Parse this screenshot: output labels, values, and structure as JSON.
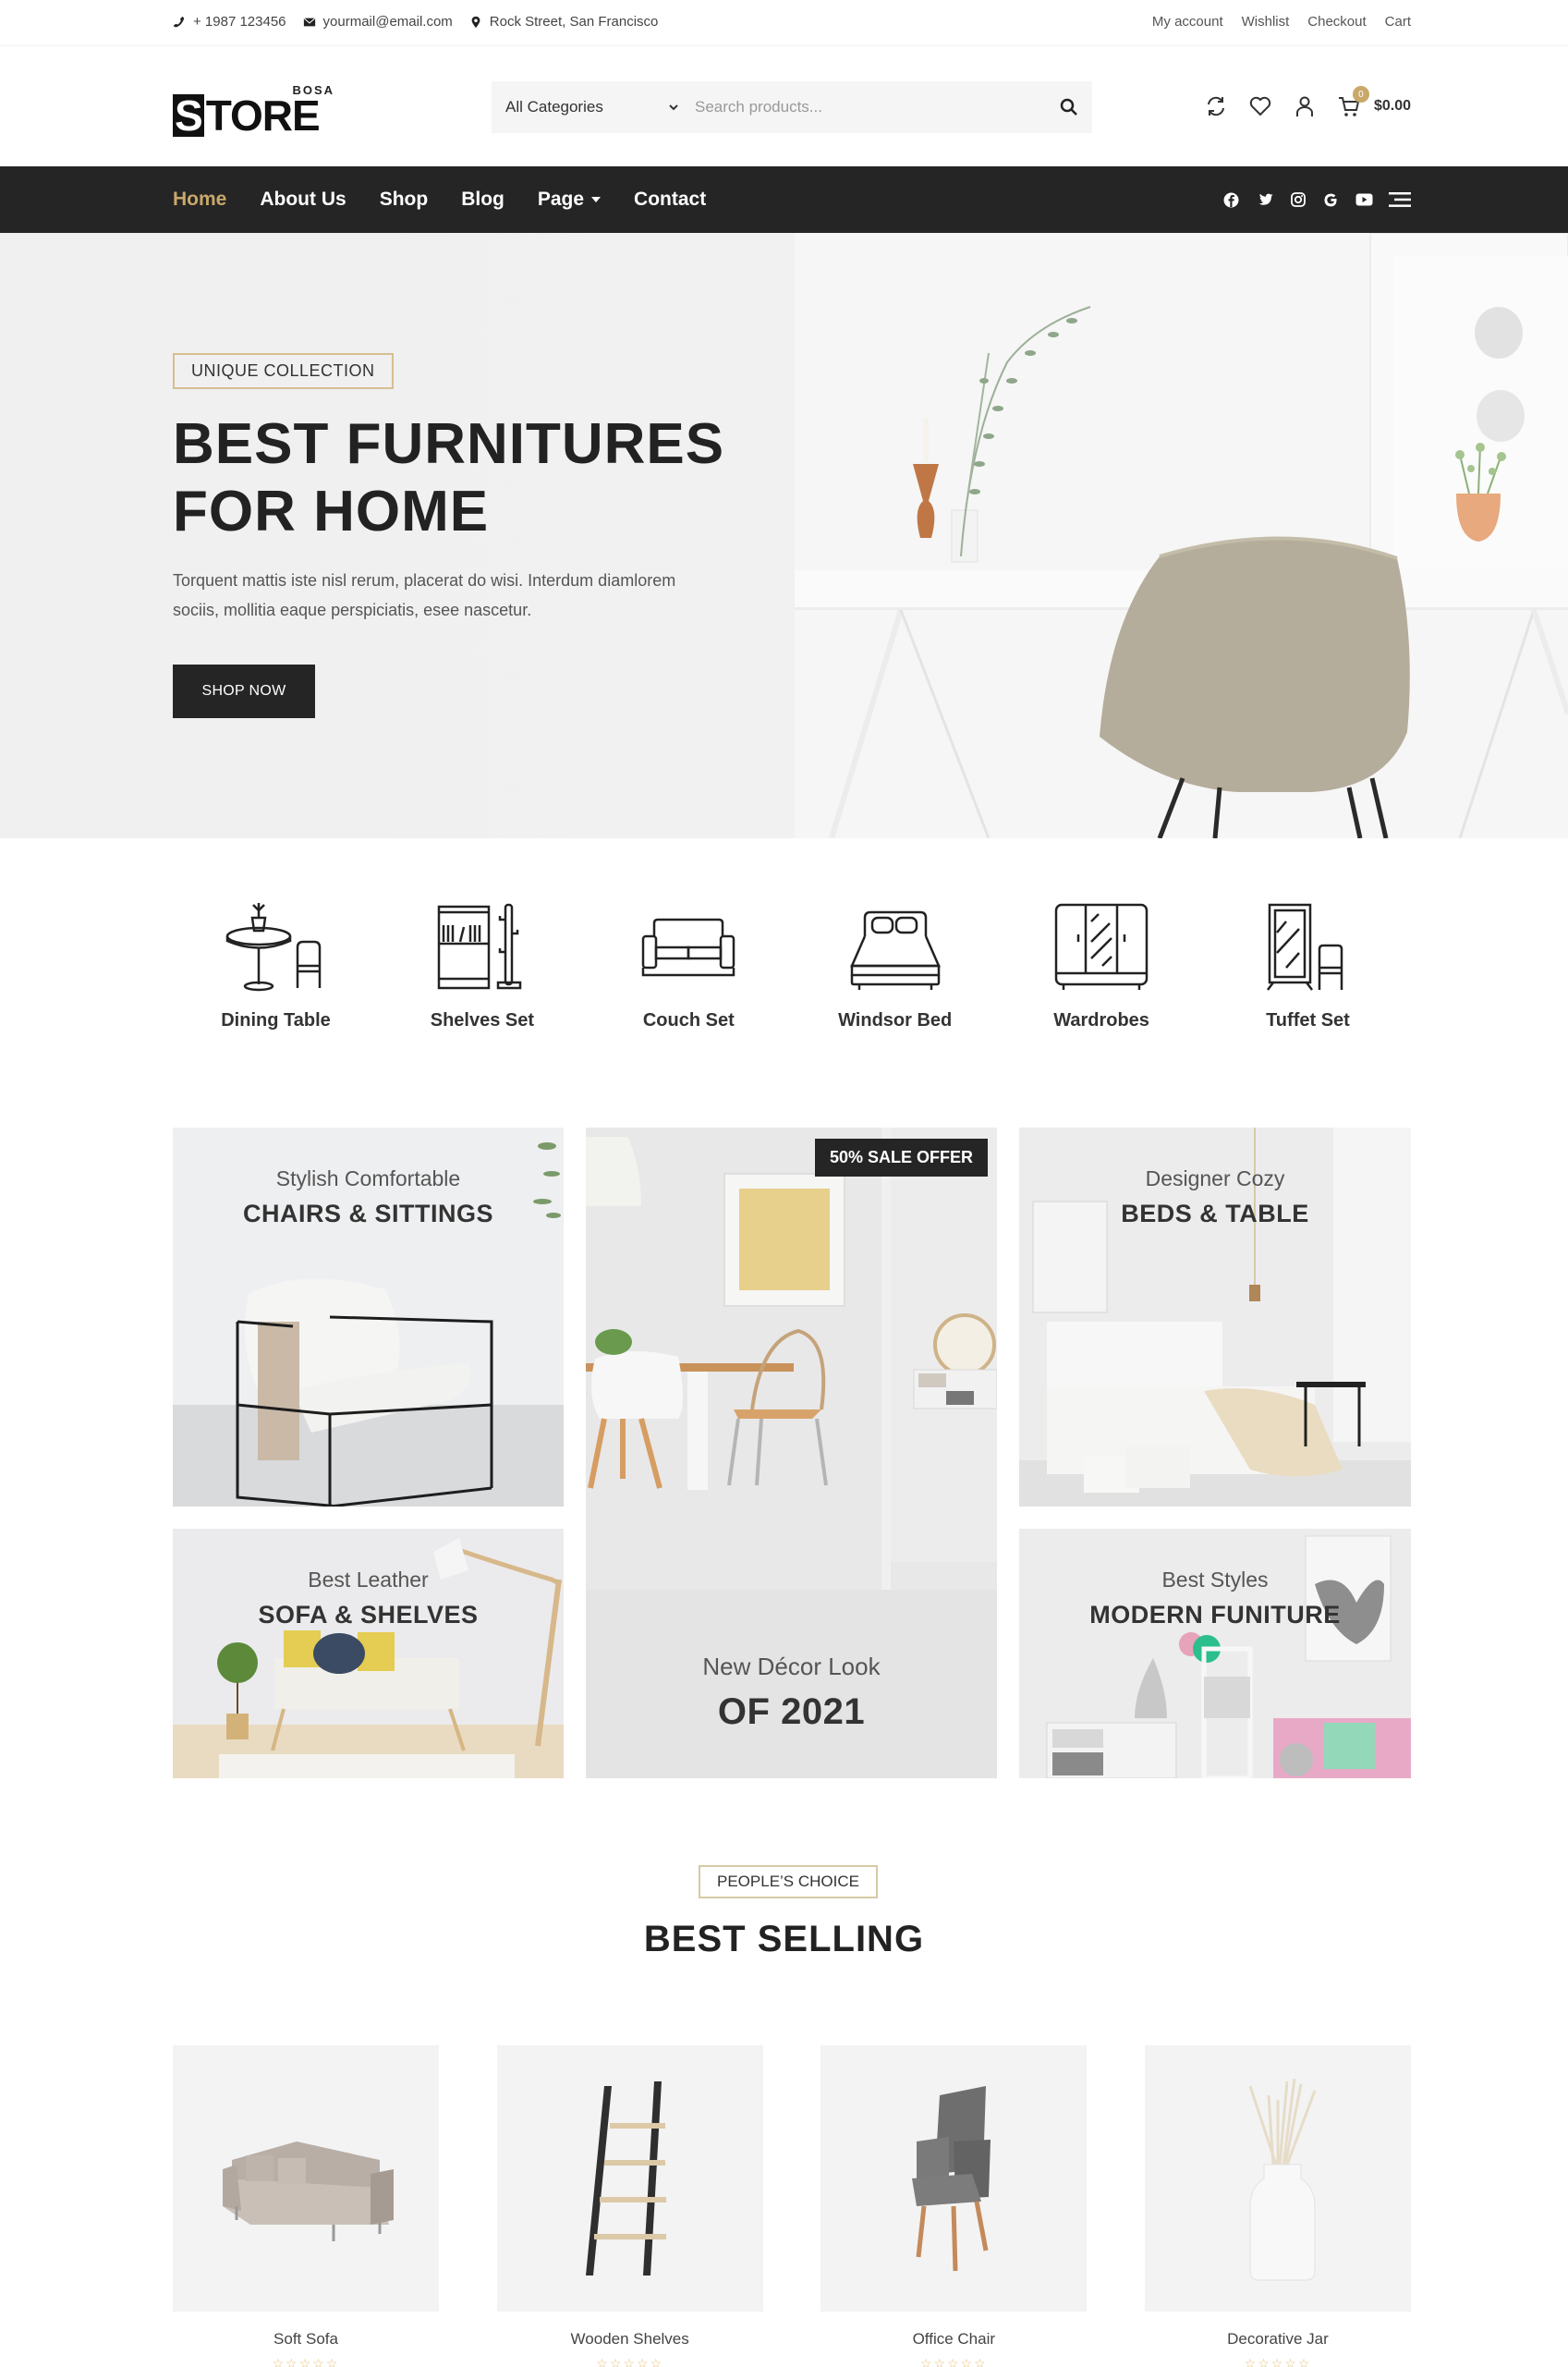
{
  "topbar": {
    "phone": "+ 1987 123456",
    "email": "yourmail@email.com",
    "address": "Rock Street, San Francisco",
    "links": [
      "My account",
      "Wishlist",
      "Checkout",
      "Cart"
    ]
  },
  "header": {
    "logo_small": "BOSA",
    "logo_main_first": "S",
    "logo_main_rest": "TORE",
    "category_select": "All Categories",
    "search_placeholder": "Search products...",
    "cart_count": "0",
    "cart_total": "$0.00"
  },
  "nav": {
    "items": [
      {
        "label": "Home",
        "active": true
      },
      {
        "label": "About Us"
      },
      {
        "label": "Shop"
      },
      {
        "label": "Blog"
      },
      {
        "label": "Page",
        "dropdown": true
      },
      {
        "label": "Contact"
      }
    ],
    "social": [
      "facebook-icon",
      "twitter-icon",
      "instagram-icon",
      "google-icon",
      "youtube-icon"
    ]
  },
  "hero": {
    "tag": "UNIQUE COLLECTION",
    "title_line1": "BEST FURNITURES",
    "title_line2": "FOR HOME",
    "description": "Torquent mattis iste nisl rerum, placerat do wisi. Interdum diamlorem sociis, mollitia eaque perspiciatis, esee nascetur.",
    "button": "SHOP NOW"
  },
  "categories": [
    {
      "label": "Dining Table",
      "icon": "dining-table-icon"
    },
    {
      "label": "Shelves Set",
      "icon": "shelves-icon"
    },
    {
      "label": "Couch Set",
      "icon": "couch-icon"
    },
    {
      "label": "Windsor Bed",
      "icon": "bed-icon"
    },
    {
      "label": "Wardrobes",
      "icon": "wardrobe-icon"
    },
    {
      "label": "Tuffet Set",
      "icon": "mirror-chair-icon"
    }
  ],
  "banners": {
    "chairs": {
      "sub": "Stylish Comfortable",
      "main": "CHAIRS & SITTINGS"
    },
    "decor": {
      "badge": "50% SALE OFFER",
      "sub": "New Décor Look",
      "main": "OF 2021"
    },
    "beds": {
      "sub": "Designer Cozy",
      "main": "BEDS & TABLE"
    },
    "sofa": {
      "sub": "Best Leather",
      "main": "SOFA & SHELVES"
    },
    "modern": {
      "sub": "Best Styles",
      "main": "MODERN FUNITURE"
    }
  },
  "best_selling": {
    "tag": "PEOPLE’S CHOICE",
    "title": "BEST SELLING",
    "products": [
      {
        "name": "Soft Sofa",
        "rating": "☆☆☆☆☆"
      },
      {
        "name": "Wooden Shelves",
        "rating": "☆☆☆☆☆"
      },
      {
        "name": "Office Chair",
        "rating": "☆☆☆☆☆"
      },
      {
        "name": "Decorative Jar",
        "rating": "☆☆☆☆☆"
      }
    ]
  }
}
